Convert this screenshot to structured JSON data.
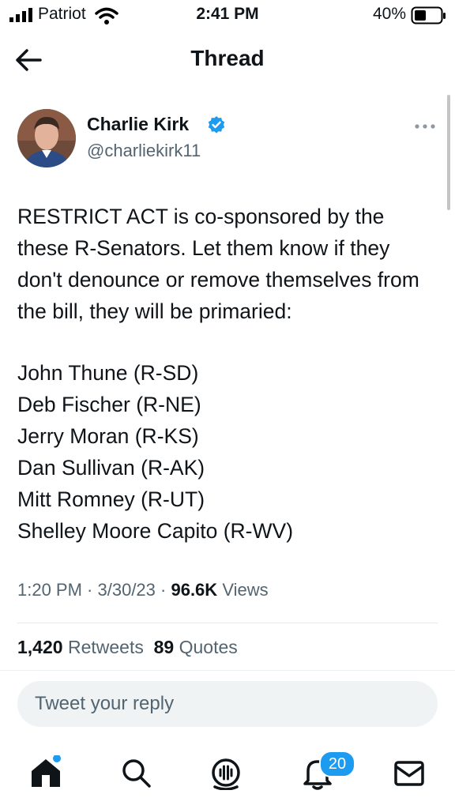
{
  "status_bar": {
    "carrier": "Patriot",
    "time": "2:41 PM",
    "battery": "40%"
  },
  "header": {
    "title": "Thread",
    "back_icon": "arrow-left-icon"
  },
  "author": {
    "name": "Charlie Kirk",
    "handle": "@charliekirk11",
    "verified": true,
    "verified_color": "#1d9bf0"
  },
  "tweet": {
    "text": "RESTRICT ACT is co-sponsored by the these R-Senators. Let them know if they don't denounce or remove themselves from the bill, they will be primaried:",
    "senators": [
      "John Thune (R-SD)",
      "Deb Fischer (R-NE)",
      "Jerry Moran (R-KS)",
      "Dan Sullivan (R-AK)",
      "Mitt Romney (R-UT)",
      "Shelley Moore Capito (R-WV)"
    ],
    "time": "1:20 PM",
    "date": "3/30/23",
    "views_count": "96.6K",
    "views_label": "Views"
  },
  "stats": {
    "retweets_count": "1,420",
    "retweets_label": "Retweets",
    "quotes_count": "89",
    "quotes_label": "Quotes"
  },
  "reply": {
    "placeholder": "Tweet your reply"
  },
  "tab_bar": {
    "items": [
      {
        "icon": "home-icon",
        "has_dot": true
      },
      {
        "icon": "search-icon"
      },
      {
        "icon": "spaces-icon"
      },
      {
        "icon": "notifications-icon",
        "badge": "20"
      },
      {
        "icon": "messages-icon"
      }
    ],
    "accent_color": "#1d9bf0"
  }
}
